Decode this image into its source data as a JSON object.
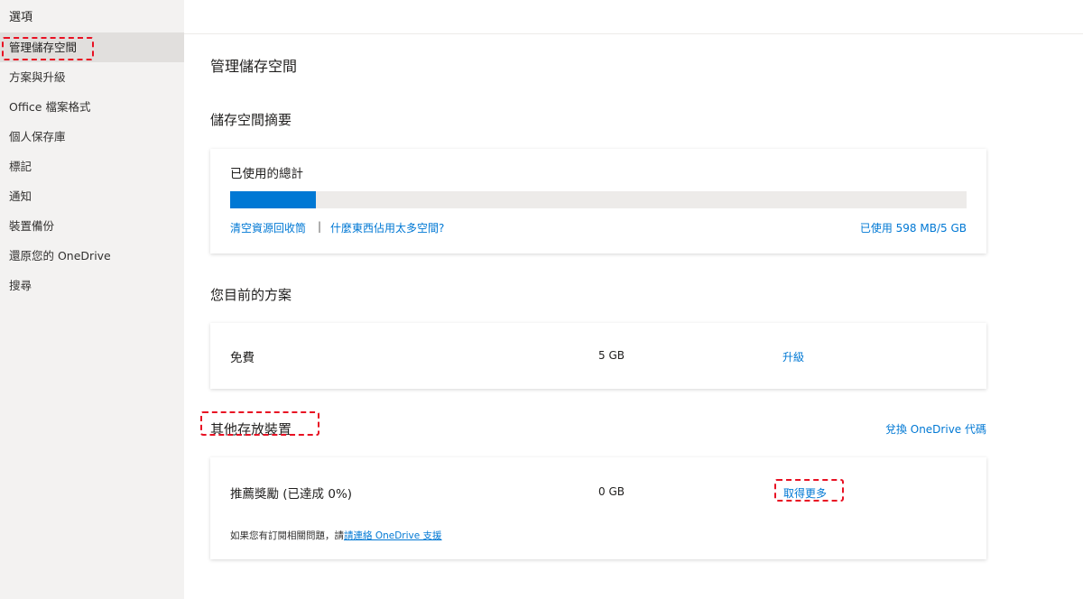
{
  "sidebar": {
    "title": "選項",
    "items": [
      {
        "label": "管理儲存空間",
        "selected": true
      },
      {
        "label": "方案與升級"
      },
      {
        "label": "Office 檔案格式"
      },
      {
        "label": "個人保存庫"
      },
      {
        "label": "標記"
      },
      {
        "label": "通知"
      },
      {
        "label": "裝置備份"
      },
      {
        "label": "還原您的 OneDrive"
      },
      {
        "label": "搜尋"
      }
    ]
  },
  "main": {
    "page_title": "管理儲存空間",
    "summary": {
      "heading": "儲存空間摘要",
      "card_label": "已使用的總計",
      "usage_fraction": 0.117,
      "empty_recycle_link": "清空資源回收筒",
      "separator": "|",
      "what_takes_space_link": "什麼東西佔用太多空間?",
      "usage_text": "已使用 598 MB/5 GB"
    },
    "plan": {
      "heading": "您目前的方案",
      "name": "免費",
      "size": "5 GB",
      "upgrade_link": "升級"
    },
    "other": {
      "heading": "其他存放裝置",
      "redeem_link": "兌換 OneDrive 代碼",
      "referral_label": "推薦獎勵 (已達成 0%)",
      "referral_size": "0 GB",
      "get_more_link": "取得更多",
      "note_prefix": "如果您有訂閱相關問題，請",
      "note_link": "請連絡 OneDrive 支援"
    }
  },
  "colors": {
    "accent": "#0078d4",
    "highlight": "#e81123",
    "sidebar_bg": "#f3f2f1"
  }
}
